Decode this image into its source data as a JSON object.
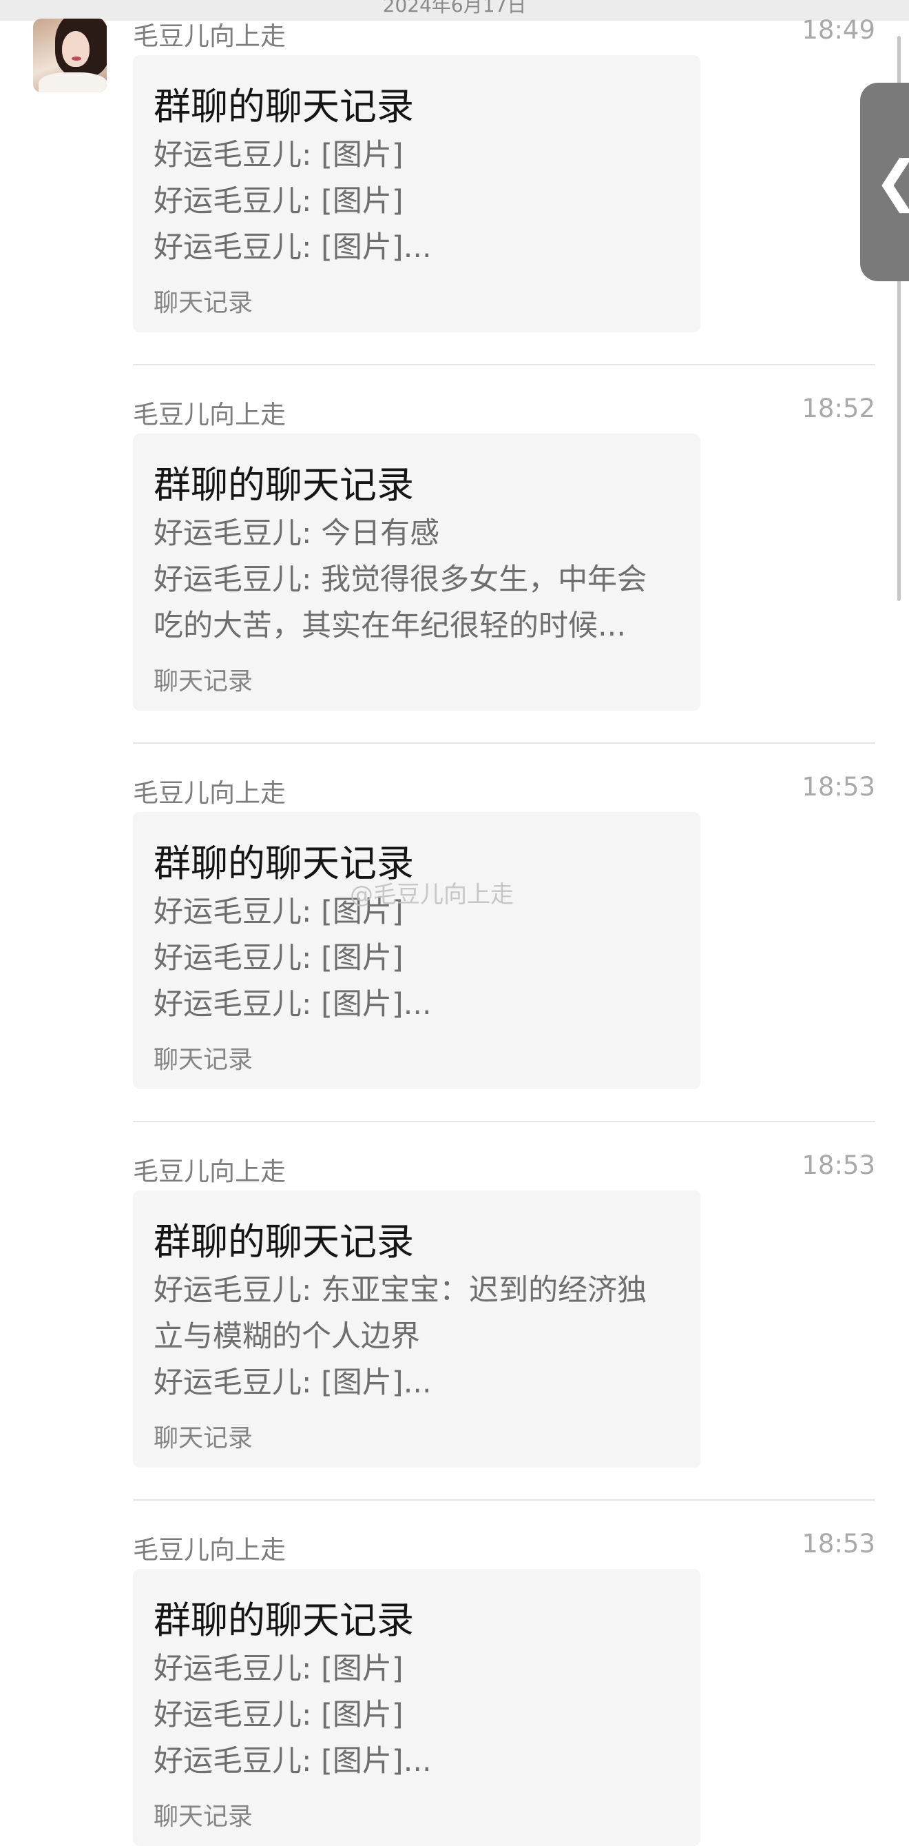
{
  "date_header": "2024年6月17日",
  "side_tab": {
    "glyph": "❮"
  },
  "watermark": "@毛豆儿向上走",
  "messages": [
    {
      "sender": "毛豆儿向上走",
      "time": "18:49",
      "card": {
        "title": "群聊的聊天记录",
        "lines": [
          "好运毛豆儿: [图片]",
          "好运毛豆儿: [图片]",
          "好运毛豆儿: [图片]..."
        ],
        "footer": "聊天记录"
      }
    },
    {
      "sender": "毛豆儿向上走",
      "time": "18:52",
      "card": {
        "title": "群聊的聊天记录",
        "lines": [
          "好运毛豆儿: 今日有感",
          "好运毛豆儿: 我觉得很多女生，中年会",
          "吃的大苦，其实在年纪很轻的时候..."
        ],
        "footer": "聊天记录"
      }
    },
    {
      "sender": "毛豆儿向上走",
      "time": "18:53",
      "card": {
        "title": "群聊的聊天记录",
        "lines": [
          "好运毛豆儿: [图片]",
          "好运毛豆儿: [图片]",
          "好运毛豆儿: [图片]..."
        ],
        "footer": "聊天记录"
      }
    },
    {
      "sender": "毛豆儿向上走",
      "time": "18:53",
      "card": {
        "title": "群聊的聊天记录",
        "lines": [
          "好运毛豆儿: 东亚宝宝：迟到的经济独",
          "立与模糊的个人边界",
          "好运毛豆儿: [图片]..."
        ],
        "footer": "聊天记录"
      }
    },
    {
      "sender": "毛豆儿向上走",
      "time": "18:53",
      "card": {
        "title": "群聊的聊天记录",
        "lines": [
          "好运毛豆儿: [图片]",
          "好运毛豆儿: [图片]",
          "好运毛豆儿: [图片]..."
        ],
        "footer": "聊天记录"
      }
    }
  ]
}
